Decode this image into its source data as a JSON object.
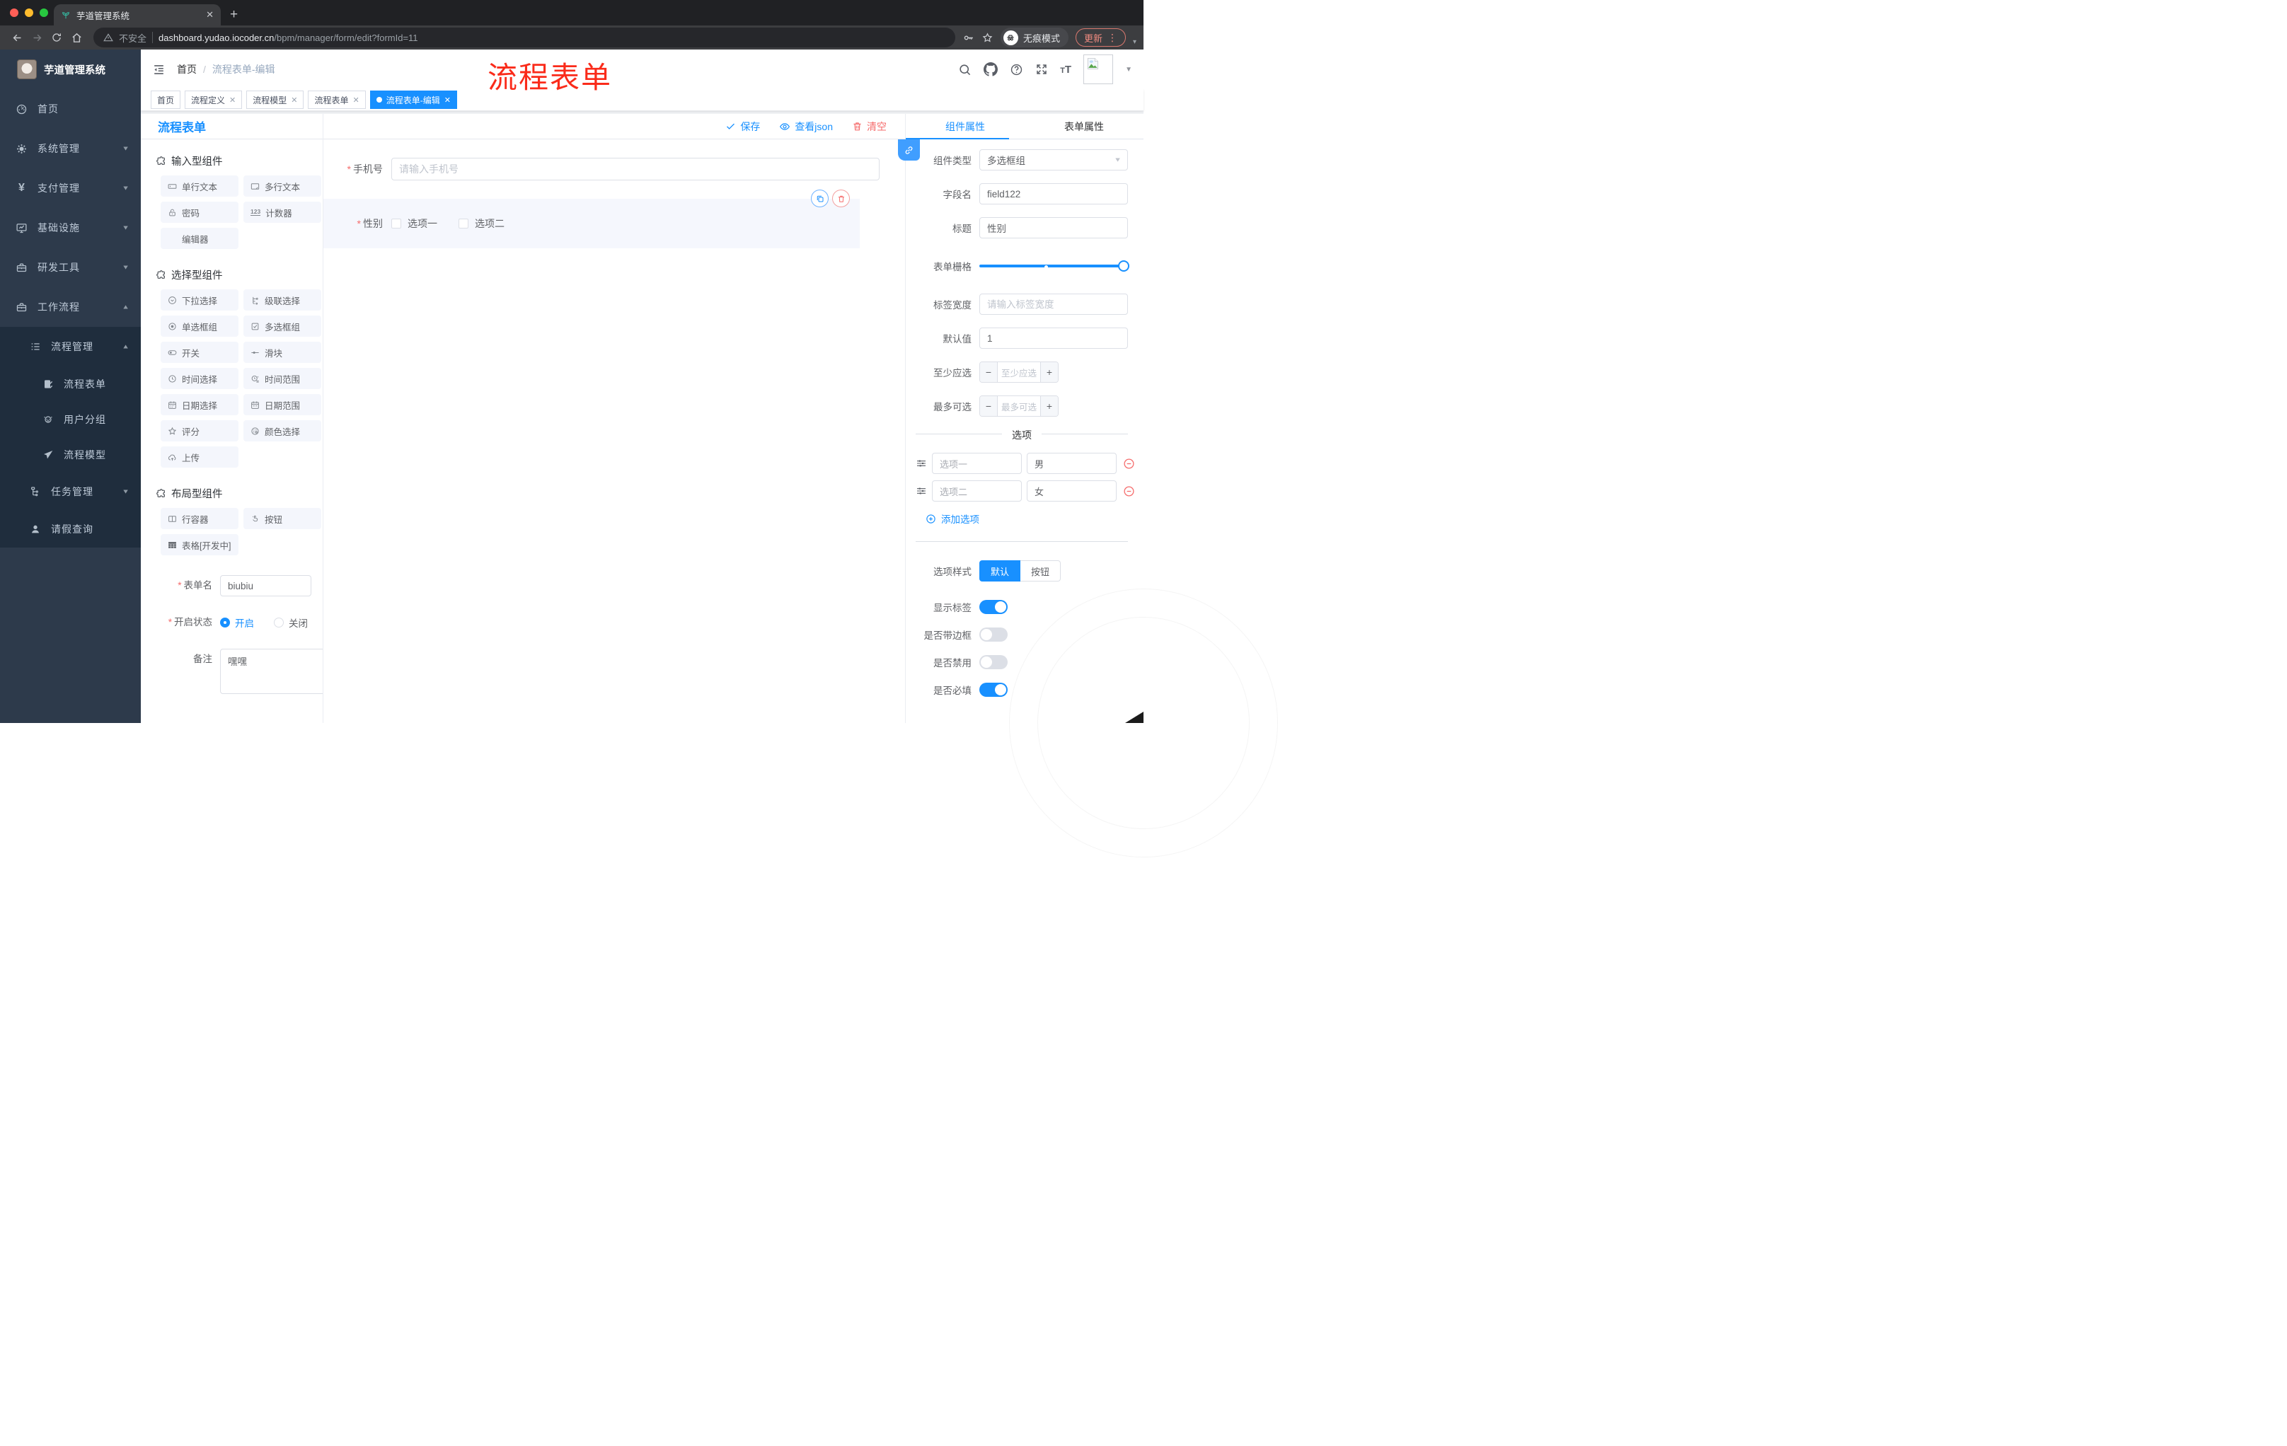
{
  "colors": {
    "primary": "#1890ff",
    "danger": "#f56c6c",
    "sidebar_bg": "#2d3a4b",
    "tag_active": "#1890ff"
  },
  "browser": {
    "tab_title": "芋道管理系统",
    "security_label": "不安全",
    "url_domain": "dashboard.yudao.iocoder.cn",
    "url_path": "/bpm/manager/form/edit?formId=11",
    "incognito_label": "无痕模式",
    "update_label": "更新"
  },
  "sidebar": {
    "app_title": "芋道管理系统",
    "items": [
      {
        "label": "首页"
      },
      {
        "label": "系统管理"
      },
      {
        "label": "支付管理"
      },
      {
        "label": "基础设施"
      },
      {
        "label": "研发工具"
      },
      {
        "label": "工作流程"
      }
    ],
    "sub": {
      "manage": "流程管理",
      "children": [
        "流程表单",
        "用户分组",
        "流程模型"
      ],
      "tasks": "任务管理",
      "leave": "请假查询"
    }
  },
  "navbar": {
    "breadcrumb_home": "首页",
    "breadcrumb_sep": "/",
    "breadcrumb_current": "流程表单-编辑",
    "annotation": "流程表单"
  },
  "tags": {
    "items": [
      {
        "label": "首页",
        "closable": false,
        "active": false
      },
      {
        "label": "流程定义",
        "closable": true,
        "active": false
      },
      {
        "label": "流程模型",
        "closable": true,
        "active": false
      },
      {
        "label": "流程表单",
        "closable": true,
        "active": false
      },
      {
        "label": "流程表单-编辑",
        "closable": true,
        "active": true
      }
    ]
  },
  "left_panel": {
    "title": "流程表单",
    "sections": [
      {
        "title": "输入型组件",
        "items": [
          {
            "label": "单行文本"
          },
          {
            "label": "多行文本"
          },
          {
            "label": "密码"
          },
          {
            "label": "计数器"
          },
          {
            "label": "编辑器"
          }
        ]
      },
      {
        "title": "选择型组件",
        "items": [
          {
            "label": "下拉选择"
          },
          {
            "label": "级联选择"
          },
          {
            "label": "单选框组"
          },
          {
            "label": "多选框组"
          },
          {
            "label": "开关"
          },
          {
            "label": "滑块"
          },
          {
            "label": "时间选择"
          },
          {
            "label": "时间范围"
          },
          {
            "label": "日期选择"
          },
          {
            "label": "日期范围"
          },
          {
            "label": "评分"
          },
          {
            "label": "颜色选择"
          },
          {
            "label": "上传"
          }
        ]
      },
      {
        "title": "布局型组件",
        "items": [
          {
            "label": "行容器"
          },
          {
            "label": "按钮"
          },
          {
            "label": "表格[开发中]"
          }
        ]
      }
    ],
    "form": {
      "name_label": "表单名",
      "name_value": "biubiu",
      "status_label": "开启状态",
      "status_on": "开启",
      "status_off": "关闭",
      "status_value": "开启",
      "remark_label": "备注",
      "remark_value": "嘿嘿"
    }
  },
  "canvas": {
    "save_label": "保存",
    "view_json_label": "查看json",
    "clear_label": "清空",
    "phone": {
      "label": "手机号",
      "placeholder": "请输入手机号",
      "value": ""
    },
    "gender": {
      "label": "性别",
      "options": [
        "选项一",
        "选项二"
      ],
      "checked": []
    }
  },
  "right_panel": {
    "tabs": {
      "component": "组件属性",
      "form": "表单属性"
    },
    "type": {
      "label": "组件类型",
      "value": "多选框组"
    },
    "field": {
      "label": "字段名",
      "value": "field122"
    },
    "title_field": {
      "label": "标题",
      "value": "性别"
    },
    "grid": {
      "label": "表单栅格"
    },
    "label_width": {
      "label": "标签宽度",
      "placeholder": "请输入标签宽度",
      "value": ""
    },
    "default_value": {
      "label": "默认值",
      "value": "1"
    },
    "min_select": {
      "label": "至少应选",
      "placeholder": "至少应选"
    },
    "max_select": {
      "label": "最多可选",
      "placeholder": "最多可选"
    },
    "options": {
      "divider": "选项",
      "rows": [
        {
          "name": "选项一",
          "value": "男"
        },
        {
          "name": "选项二",
          "value": "女"
        }
      ],
      "add_label": "添加选项"
    },
    "style": {
      "label": "选项样式",
      "options": [
        "默认",
        "按钮"
      ],
      "selected": "默认"
    },
    "toggles": [
      {
        "label": "显示标签",
        "on": true
      },
      {
        "label": "是否带边框",
        "on": false
      },
      {
        "label": "是否禁用",
        "on": false
      },
      {
        "label": "是否必填",
        "on": true
      }
    ]
  }
}
